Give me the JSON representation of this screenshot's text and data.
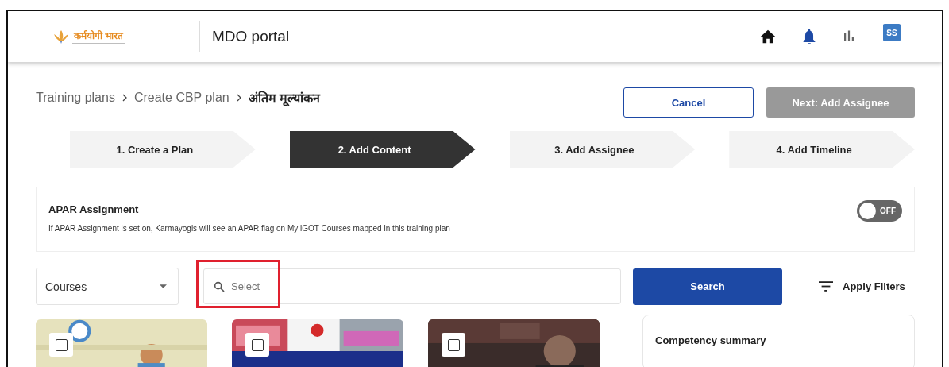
{
  "header": {
    "logo_text": "कर्मयोगी भारत",
    "title": "MDO portal",
    "avatar": "SS"
  },
  "breadcrumb": [
    {
      "label": "Training plans",
      "current": false
    },
    {
      "label": "Create CBP plan",
      "current": false
    },
    {
      "label": "अंतिम मूल्यांकन",
      "current": true
    }
  ],
  "actions": {
    "cancel": "Cancel",
    "next": {
      "label": "Next: Add Assignee",
      "disabled": true
    }
  },
  "steps": [
    {
      "label": "1. Create a Plan",
      "selected": false
    },
    {
      "label": "2. Add Content",
      "selected": true
    },
    {
      "label": "3. Add Assignee",
      "selected": false
    },
    {
      "label": "4. Add Timeline",
      "selected": false
    }
  ],
  "apar": {
    "title": "APAR Assignment",
    "description": "If APAR Assignment is set on, Karmayogis will see an APAR flag on My iGOT Courses mapped in this training plan",
    "toggle": {
      "on": false,
      "label": "OFF"
    }
  },
  "filters": {
    "type_dropdown": "Courses",
    "search": {
      "placeholder": "Select",
      "highlighted": true
    },
    "search_button": "Search",
    "apply_filters": "Apply Filters"
  },
  "competency_summary": {
    "title": "Competency summary"
  }
}
